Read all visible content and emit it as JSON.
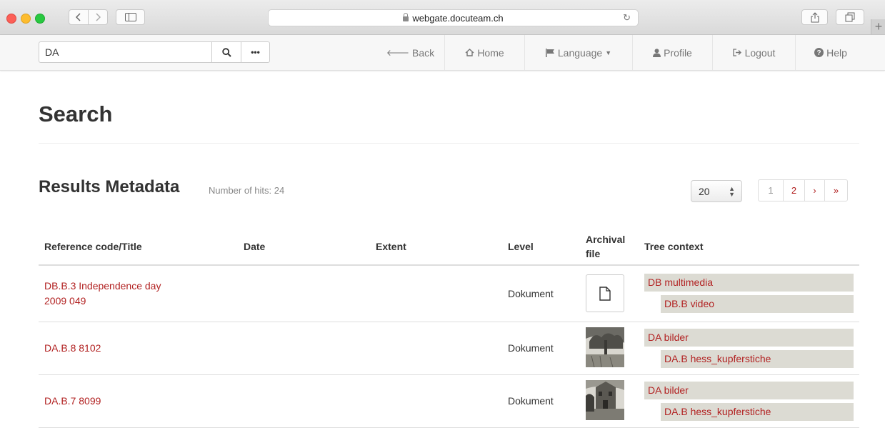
{
  "browser": {
    "url": "webgate.docuteam.ch",
    "new_tab": "+"
  },
  "navbar": {
    "search": {
      "value": "DA"
    },
    "more_label": "•••",
    "items": [
      {
        "icon": "arrow-left-icon",
        "label": "Back"
      },
      {
        "icon": "home-icon",
        "label": "Home"
      },
      {
        "icon": "flag-icon",
        "label": "Language"
      },
      {
        "icon": "user-icon",
        "label": "Profile"
      },
      {
        "icon": "logout-icon",
        "label": "Logout"
      },
      {
        "icon": "help-icon",
        "label": "Help"
      }
    ]
  },
  "page": {
    "title": "Search",
    "results_title": "Results Metadata",
    "hits": "Number of hits: 24",
    "page_size": "20",
    "pagination": [
      "1",
      "2",
      "›",
      "»"
    ]
  },
  "table": {
    "headers": [
      "Reference code/Title",
      "Date",
      "Extent",
      "Level",
      "Archival file",
      "Tree context"
    ],
    "rows": [
      {
        "title": "DB.B.3 Independence day 2009 049",
        "date": "",
        "extent": "",
        "level": "Dokument",
        "archival": "file-icon",
        "tree": [
          "DB multimedia",
          "DB.B video"
        ]
      },
      {
        "title": "DA.B.8 8102",
        "date": "",
        "extent": "",
        "level": "Dokument",
        "archival": "engraving-thumbnail",
        "tree": [
          "DA bilder",
          "DA.B hess_kupferstiche"
        ]
      },
      {
        "title": "DA.B.7 8099",
        "date": "",
        "extent": "",
        "level": "Dokument",
        "archival": "engraving-thumbnail",
        "tree": [
          "DA bilder",
          "DA.B hess_kupferstiche"
        ]
      }
    ]
  },
  "colors": {
    "link": "#b22222",
    "tree_bg": "#dcdbd3",
    "navbar_bg": "#f7f7f7"
  }
}
